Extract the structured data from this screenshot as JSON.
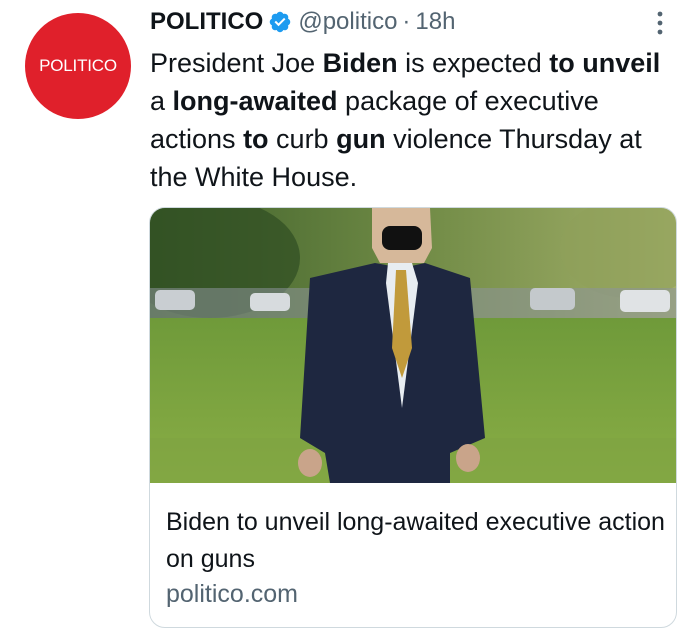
{
  "tweet": {
    "avatar_text": "POLITICO",
    "author_name": "POLITICO",
    "handle": "@politico",
    "separator": "·",
    "time": "18h",
    "text": [
      {
        "t": "President Joe ",
        "b": false
      },
      {
        "t": "Biden",
        "b": true
      },
      {
        "t": " is expected ",
        "b": false
      },
      {
        "t": "to",
        "b": true
      },
      {
        "t": " ",
        "b": false
      },
      {
        "t": "unveil",
        "b": true
      },
      {
        "t": " a ",
        "b": false
      },
      {
        "t": "long-awaited",
        "b": true
      },
      {
        "t": " package of executive actions ",
        "b": false
      },
      {
        "t": "to",
        "b": true
      },
      {
        "t": " curb ",
        "b": false
      },
      {
        "t": "gun",
        "b": true
      },
      {
        "t": " violence Thursday at the White House.",
        "b": false
      }
    ],
    "card": {
      "title": "Biden to unveil long-awaited executive action on guns",
      "domain": "politico.com"
    }
  },
  "icons": {
    "verified": "verified-badge-icon",
    "more": "more-vertical-icon"
  },
  "colors": {
    "brand_red": "#e0202b",
    "verified_blue": "#1d9bf0",
    "muted_text": "#536471",
    "text": "#0f1419",
    "border": "#cfd9de"
  }
}
